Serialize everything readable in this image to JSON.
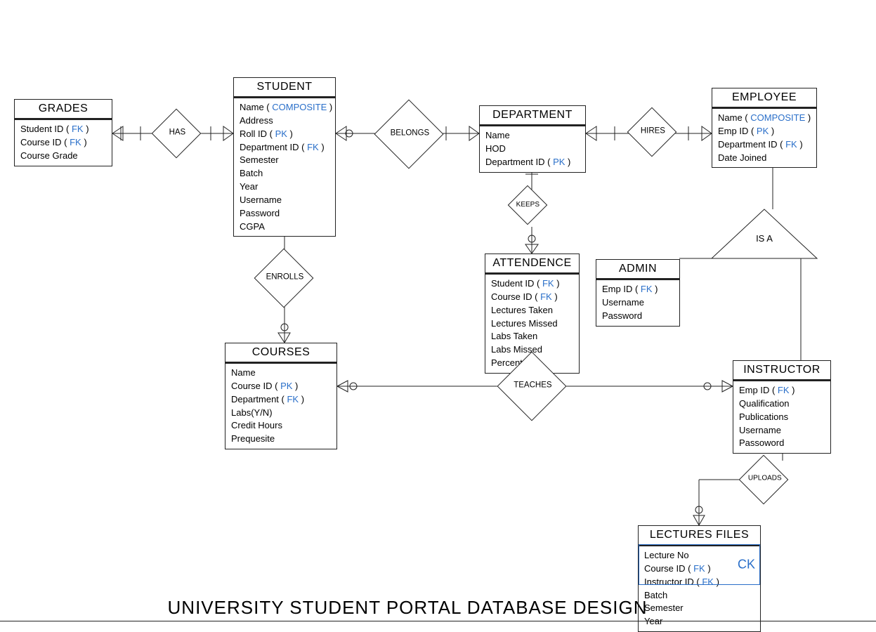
{
  "title": "UNIVERSITY STUDENT PORTAL DATABASE DESIGN",
  "entities": {
    "grades": {
      "name": "GRADES",
      "attrs": [
        {
          "text": "Student ID",
          "key": "FK"
        },
        {
          "text": "Course ID",
          "key": "FK"
        },
        {
          "text": "Course Grade",
          "key": ""
        }
      ]
    },
    "student": {
      "name": "STUDENT",
      "attrs": [
        {
          "text": "Name",
          "key": "COMPOSITE"
        },
        {
          "text": "Address",
          "key": ""
        },
        {
          "text": "Roll ID",
          "key": "PK"
        },
        {
          "text": "Department ID",
          "key": "FK"
        },
        {
          "text": "Semester",
          "key": ""
        },
        {
          "text": "Batch",
          "key": ""
        },
        {
          "text": "Year",
          "key": ""
        },
        {
          "text": "Username",
          "key": ""
        },
        {
          "text": "Password",
          "key": ""
        },
        {
          "text": "CGPA",
          "key": ""
        }
      ]
    },
    "department": {
      "name": "DEPARTMENT",
      "attrs": [
        {
          "text": "Name",
          "key": ""
        },
        {
          "text": "HOD",
          "key": ""
        },
        {
          "text": "Department ID",
          "key": "PK"
        }
      ]
    },
    "employee": {
      "name": "EMPLOYEE",
      "attrs": [
        {
          "text": "Name",
          "key": "COMPOSITE"
        },
        {
          "text": "Emp ID",
          "key": "PK"
        },
        {
          "text": "Department ID",
          "key": "FK"
        },
        {
          "text": "Date Joined",
          "key": ""
        }
      ]
    },
    "attendence": {
      "name": "ATTENDENCE",
      "attrs": [
        {
          "text": "Student ID",
          "key": "FK"
        },
        {
          "text": "Course ID",
          "key": "FK"
        },
        {
          "text": "Lectures Taken",
          "key": ""
        },
        {
          "text": "Lectures Missed",
          "key": ""
        },
        {
          "text": "Labs Taken",
          "key": ""
        },
        {
          "text": "Labs Missed",
          "key": ""
        },
        {
          "text": "Percentage",
          "key": ""
        }
      ]
    },
    "admin": {
      "name": "ADMIN",
      "attrs": [
        {
          "text": "Emp ID",
          "key": "FK"
        },
        {
          "text": "Username",
          "key": ""
        },
        {
          "text": "Password",
          "key": ""
        }
      ]
    },
    "courses": {
      "name": "COURSES",
      "attrs": [
        {
          "text": "Name",
          "key": ""
        },
        {
          "text": "Course ID",
          "key": "PK"
        },
        {
          "text": "Department",
          "key": "FK"
        },
        {
          "text": "Labs(Y/N)",
          "key": ""
        },
        {
          "text": "Credit Hours",
          "key": ""
        },
        {
          "text": "Prequesite",
          "key": ""
        }
      ]
    },
    "instructor": {
      "name": "INSTRUCTOR",
      "attrs": [
        {
          "text": "Emp ID",
          "key": "FK"
        },
        {
          "text": "Qualification",
          "key": ""
        },
        {
          "text": "Publications",
          "key": ""
        },
        {
          "text": "Username",
          "key": ""
        },
        {
          "text": "Passoword",
          "key": ""
        }
      ]
    },
    "lectures_files": {
      "name": "LECTURES FILES",
      "attrs": [
        {
          "text": "Lecture No",
          "key": ""
        },
        {
          "text": "Course ID",
          "key": "FK"
        },
        {
          "text": "Instructor ID",
          "key": "FK"
        },
        {
          "text": "Batch",
          "key": ""
        },
        {
          "text": "Semester",
          "key": ""
        },
        {
          "text": "Year",
          "key": ""
        }
      ],
      "ck_label": "CK"
    }
  },
  "relationships": {
    "has": "HAS",
    "belongs": "BELONGS",
    "hires": "HIRES",
    "keeps": "KEEPS",
    "enrolls": "ENROLLS",
    "teaches": "TEACHES",
    "uploads": "UPLOADS",
    "isa": "IS A"
  }
}
